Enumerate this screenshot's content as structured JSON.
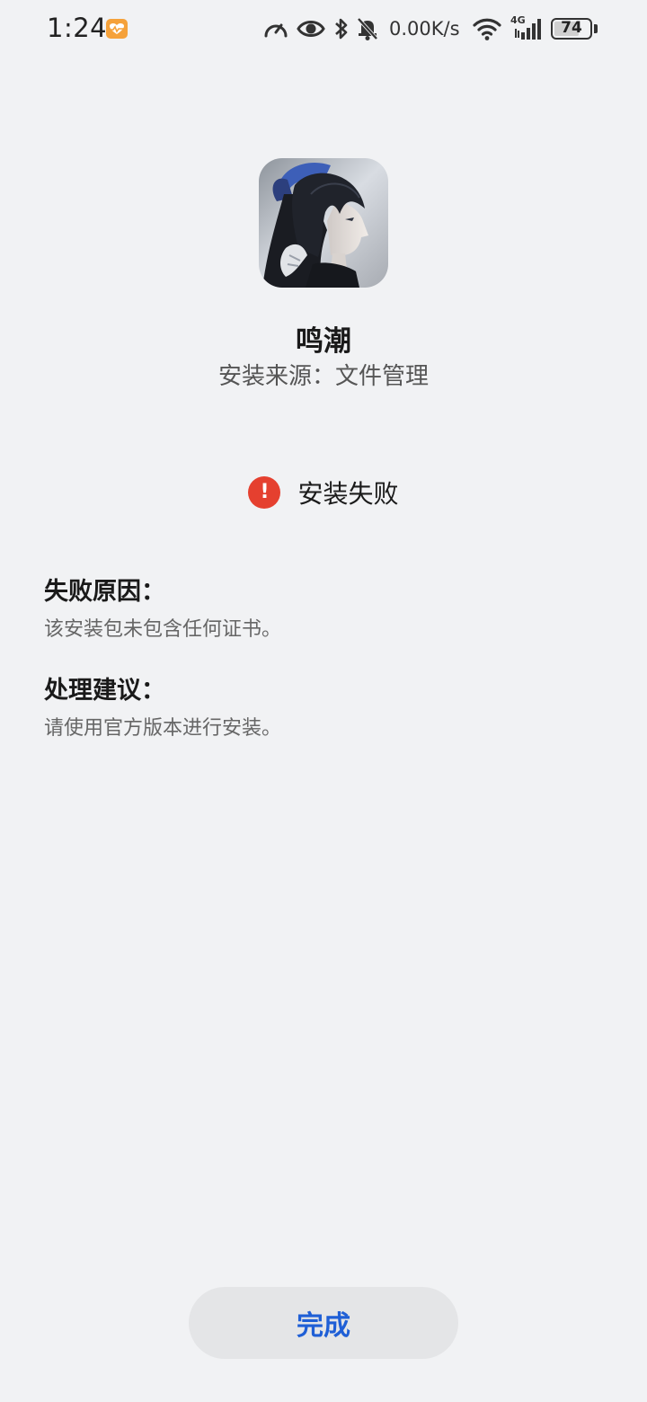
{
  "status_bar": {
    "time": "1:24",
    "net_speed": "0.00K/s",
    "network_type": "4G",
    "battery_level": "74",
    "battery_percent": 74,
    "icons": [
      "health-icon",
      "speed-meter-icon",
      "eye-comfort-icon",
      "bluetooth-icon",
      "notification-off-icon",
      "wifi-icon",
      "signal-icon"
    ]
  },
  "app": {
    "name": "鸣潮",
    "install_source": "安装来源：文件管理",
    "icon": "app-icon-character-art"
  },
  "result": {
    "text": "安装失败",
    "icon_symbol": "!",
    "color": "#e5402f"
  },
  "failure": {
    "title": "失败原因：",
    "body": "该安装包未包含任何证书。"
  },
  "advice": {
    "title": "处理建议：",
    "body": "请使用官方版本进行安装。"
  },
  "done_button": {
    "label": "完成",
    "color": "#1f5fd6"
  }
}
